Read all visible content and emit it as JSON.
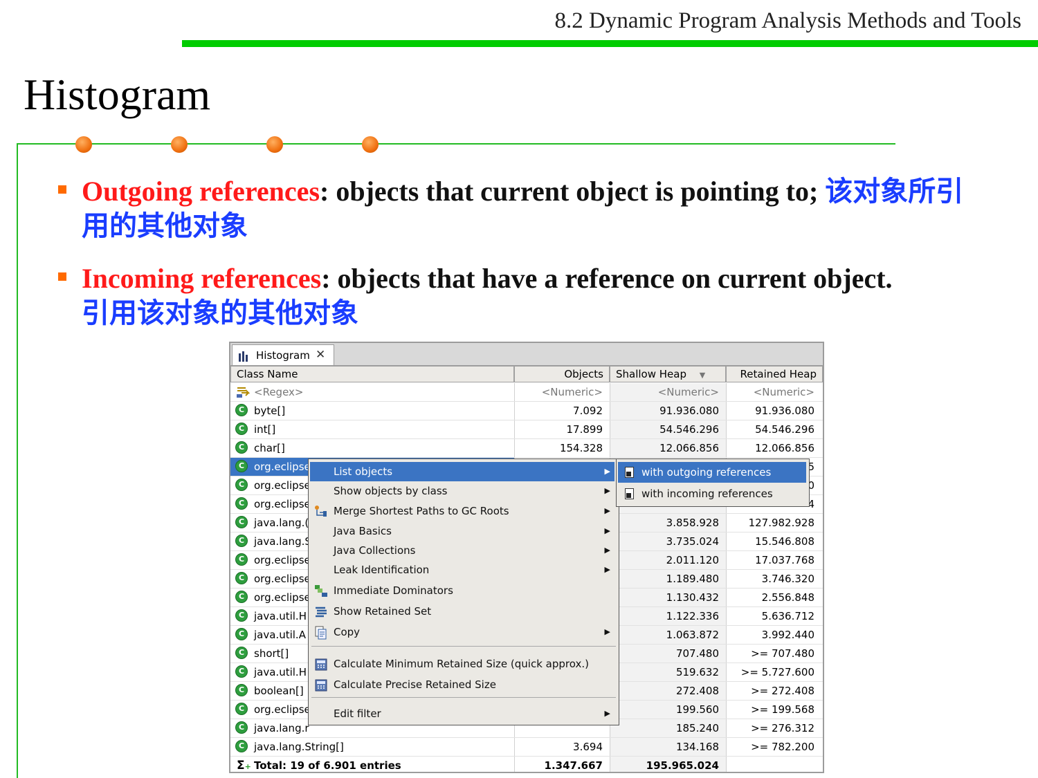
{
  "slide": {
    "header": "8.2 Dynamic Program Analysis Methods and Tools",
    "title": "Histogram",
    "accent_color": "#00cc00",
    "bullets": [
      {
        "term": "Outgoing references",
        "text": ": objects that current object is pointing to; ",
        "cn": "该对象所引用的其他对象"
      },
      {
        "term": "Incoming references",
        "text": ":  objects that have a reference on current object. ",
        "cn": "引用该对象的其他对象"
      }
    ]
  },
  "window": {
    "tab_label": "Histogram",
    "tab_icon": "histogram-icon",
    "columns": [
      "Class Name",
      "Objects",
      "Shallow Heap",
      "Retained Heap"
    ],
    "filter_row": {
      "name": "<Regex>",
      "objects": "<Numeric>",
      "shallow": "<Numeric>",
      "retained": "<Numeric>"
    },
    "rows": [
      {
        "name": "byte[]",
        "objects": "7.092",
        "shallow": "91.936.080",
        "retained": "91.936.080"
      },
      {
        "name": "int[]",
        "objects": "17.899",
        "shallow": "54.546.296",
        "retained": "54.546.296"
      },
      {
        "name": "char[]",
        "objects": "154.328",
        "shallow": "12.066.856",
        "retained": "12.066.856"
      },
      {
        "name": "org.eclipse",
        "objects": "",
        "shallow": "",
        "retained": "5",
        "selected": true
      },
      {
        "name": "org.eclipse",
        "objects": "",
        "shallow": "",
        "retained": "0"
      },
      {
        "name": "org.eclipse",
        "objects": "",
        "shallow": "",
        "retained": "4"
      },
      {
        "name": "java.lang.(",
        "objects": "",
        "shallow": "3.858.928",
        "retained": "127.982.928"
      },
      {
        "name": "java.lang.S",
        "objects": "",
        "shallow": "3.735.024",
        "retained": "15.546.808"
      },
      {
        "name": "org.eclipse",
        "objects": "",
        "shallow": "2.011.120",
        "retained": "17.037.768"
      },
      {
        "name": "org.eclipse",
        "objects": "",
        "shallow": "1.189.480",
        "retained": "3.746.320"
      },
      {
        "name": "org.eclipse",
        "objects": "",
        "shallow": "1.130.432",
        "retained": "2.556.848"
      },
      {
        "name": "java.util.H",
        "objects": "",
        "shallow": "1.122.336",
        "retained": "5.636.712"
      },
      {
        "name": "java.util.A",
        "objects": "",
        "shallow": "1.063.872",
        "retained": "3.992.440"
      },
      {
        "name": "short[]",
        "objects": "",
        "shallow": "707.480",
        "retained": ">= 707.480"
      },
      {
        "name": "java.util.H",
        "objects": "",
        "shallow": "519.632",
        "retained": ">= 5.727.600"
      },
      {
        "name": "boolean[]",
        "objects": "",
        "shallow": "272.408",
        "retained": ">= 272.408"
      },
      {
        "name": "org.eclipse",
        "objects": "",
        "shallow": "199.560",
        "retained": ">= 199.568"
      },
      {
        "name": "java.lang.r",
        "objects": "",
        "shallow": "185.240",
        "retained": ">= 276.312"
      },
      {
        "name": "java.lang.String[]",
        "objects": "3.694",
        "shallow": "134.168",
        "retained": ">= 782.200"
      }
    ],
    "total": {
      "label": "Total: 19 of 6.901 entries",
      "objects": "1.347.667",
      "shallow": "195.965.024",
      "retained": ""
    }
  },
  "context_menu": {
    "items": [
      {
        "label": "List objects",
        "submenu": true,
        "highlighted": true
      },
      {
        "label": "Show objects by class",
        "submenu": true
      },
      {
        "label": "Merge Shortest Paths to GC Roots",
        "submenu": true,
        "icon": "merge-paths-icon"
      },
      {
        "label": "Java Basics",
        "submenu": true
      },
      {
        "label": "Java Collections",
        "submenu": true
      },
      {
        "label": "Leak Identification",
        "submenu": true
      },
      {
        "label": "Immediate Dominators",
        "icon": "dominators-icon"
      },
      {
        "label": "Show Retained Set",
        "icon": "retained-set-icon"
      },
      {
        "label": "Copy",
        "submenu": true,
        "icon": "copy-icon"
      },
      {
        "label": "Calculate Minimum Retained Size (quick approx.)",
        "icon": "calculator-icon"
      },
      {
        "label": "Calculate Precise Retained Size",
        "icon": "calculator-icon"
      },
      {
        "label": "Edit filter",
        "submenu": true
      }
    ],
    "submenu": [
      {
        "label": "with outgoing references",
        "highlighted": true
      },
      {
        "label": "with incoming references"
      }
    ]
  }
}
